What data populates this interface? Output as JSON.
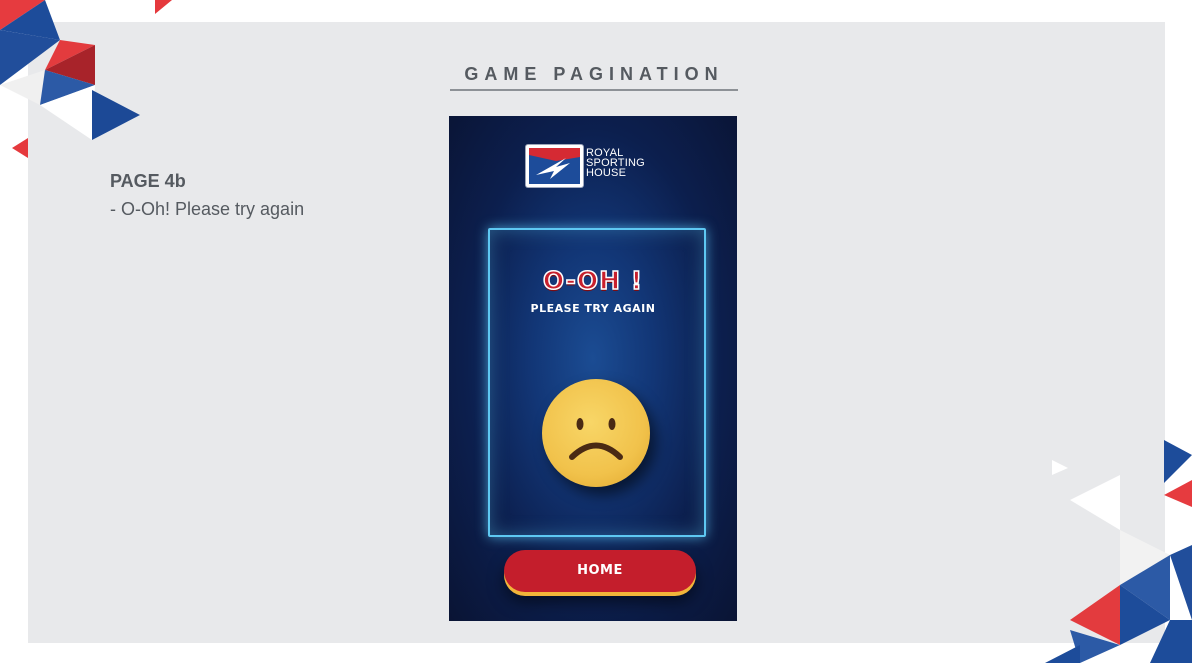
{
  "header": {
    "title": "GAME PAGINATION"
  },
  "page_info": {
    "label": "PAGE 4b",
    "description": "- O-Oh! Please try again"
  },
  "game_screen": {
    "logo": {
      "line1": "ROYAL",
      "line2": "SPORTING",
      "line3": "HOUSE"
    },
    "result_title": "O-OH !",
    "result_subtitle": "PLEASE TRY AGAIN",
    "emoji": "sad-face-icon",
    "home_button_label": "HOME"
  },
  "colors": {
    "brand_red": "#c41e2c",
    "brand_blue": "#1a4a96",
    "frame_glow": "#5ec8f2",
    "emoji_yellow": "#f1c24b",
    "button_accent": "#f2b53a"
  }
}
